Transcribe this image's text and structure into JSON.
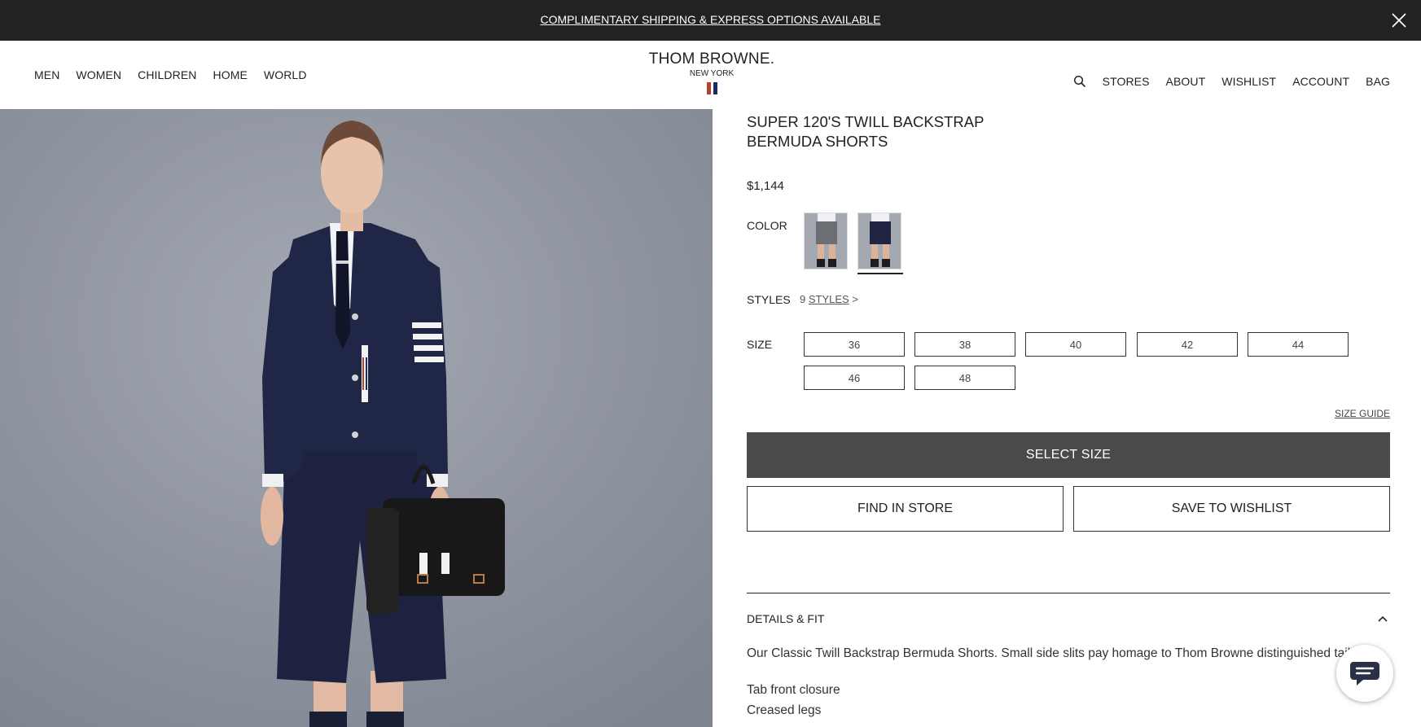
{
  "promo": {
    "text": "COMPLIMENTARY SHIPPING & EXPRESS OPTIONS AVAILABLE",
    "close_icon": "close-icon"
  },
  "header": {
    "nav_left": [
      "MEN",
      "WOMEN",
      "CHILDREN",
      "HOME",
      "WORLD"
    ],
    "brand_name": "THOM BROWNE.",
    "brand_sub": "NEW YORK",
    "flag_colors": [
      "#b5442c",
      "#ffffff",
      "#1d2a5c"
    ],
    "search_icon": "search-icon",
    "nav_right": [
      "STORES",
      "ABOUT",
      "WISHLIST",
      "ACCOUNT",
      "BAG"
    ]
  },
  "product": {
    "title": "SUPER 120'S TWILL BACKSTRAP BERMUDA SHORTS",
    "price": "$1,144",
    "color_label": "COLOR",
    "color_swatches": [
      {
        "name": "grey",
        "color": "#6b6e73",
        "selected": false
      },
      {
        "name": "navy",
        "color": "#1f2540",
        "selected": true
      }
    ],
    "styles_label": "STYLES",
    "styles_count": "9",
    "styles_link": "STYLES",
    "styles_arrow": ">",
    "size_label": "SIZE",
    "sizes": [
      "36",
      "38",
      "40",
      "42",
      "44",
      "46",
      "48"
    ],
    "size_guide": "SIZE GUIDE",
    "select_size": "SELECT SIZE",
    "find_in_store": "FIND IN STORE",
    "save_to_wishlist": "SAVE TO WISHLIST",
    "details_heading": "DETAILS & FIT",
    "description": "Our Classic Twill Backstrap Bermuda Shorts. Small side slits pay homage to Thom Browne distinguished tailoring.",
    "features": [
      "Tab front closure",
      "Creased legs"
    ]
  },
  "chat": {
    "icon": "chat-icon"
  },
  "colors": {
    "promo_bg": "#222222",
    "primary_button": "#4a4a4a",
    "image_bg": "#9197a3",
    "navy": "#1f2540"
  }
}
